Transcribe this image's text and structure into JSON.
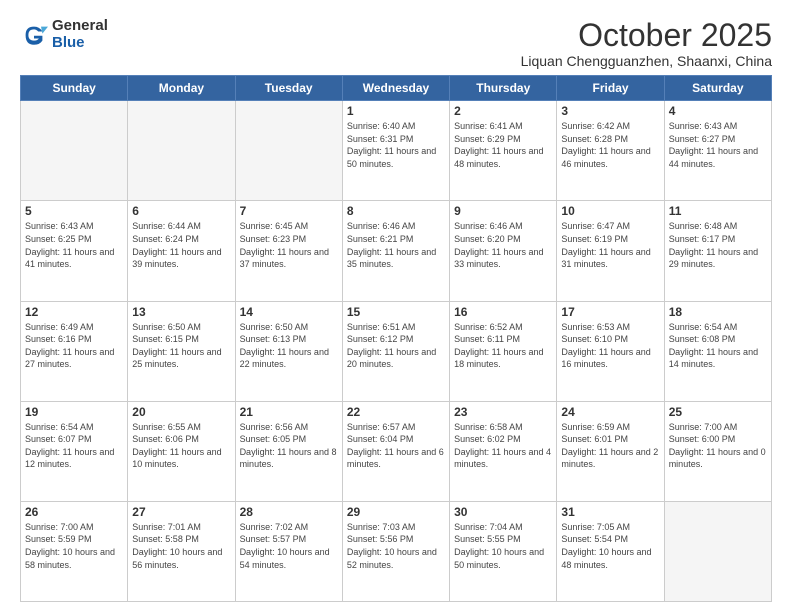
{
  "logo": {
    "general": "General",
    "blue": "Blue"
  },
  "header": {
    "month": "October 2025",
    "location": "Liquan Chengguanzhen, Shaanxi, China"
  },
  "weekdays": [
    "Sunday",
    "Monday",
    "Tuesday",
    "Wednesday",
    "Thursday",
    "Friday",
    "Saturday"
  ],
  "weeks": [
    [
      {
        "day": "",
        "sunrise": "",
        "sunset": "",
        "daylight": ""
      },
      {
        "day": "",
        "sunrise": "",
        "sunset": "",
        "daylight": ""
      },
      {
        "day": "",
        "sunrise": "",
        "sunset": "",
        "daylight": ""
      },
      {
        "day": "1",
        "sunrise": "Sunrise: 6:40 AM",
        "sunset": "Sunset: 6:31 PM",
        "daylight": "Daylight: 11 hours and 50 minutes."
      },
      {
        "day": "2",
        "sunrise": "Sunrise: 6:41 AM",
        "sunset": "Sunset: 6:29 PM",
        "daylight": "Daylight: 11 hours and 48 minutes."
      },
      {
        "day": "3",
        "sunrise": "Sunrise: 6:42 AM",
        "sunset": "Sunset: 6:28 PM",
        "daylight": "Daylight: 11 hours and 46 minutes."
      },
      {
        "day": "4",
        "sunrise": "Sunrise: 6:43 AM",
        "sunset": "Sunset: 6:27 PM",
        "daylight": "Daylight: 11 hours and 44 minutes."
      }
    ],
    [
      {
        "day": "5",
        "sunrise": "Sunrise: 6:43 AM",
        "sunset": "Sunset: 6:25 PM",
        "daylight": "Daylight: 11 hours and 41 minutes."
      },
      {
        "day": "6",
        "sunrise": "Sunrise: 6:44 AM",
        "sunset": "Sunset: 6:24 PM",
        "daylight": "Daylight: 11 hours and 39 minutes."
      },
      {
        "day": "7",
        "sunrise": "Sunrise: 6:45 AM",
        "sunset": "Sunset: 6:23 PM",
        "daylight": "Daylight: 11 hours and 37 minutes."
      },
      {
        "day": "8",
        "sunrise": "Sunrise: 6:46 AM",
        "sunset": "Sunset: 6:21 PM",
        "daylight": "Daylight: 11 hours and 35 minutes."
      },
      {
        "day": "9",
        "sunrise": "Sunrise: 6:46 AM",
        "sunset": "Sunset: 6:20 PM",
        "daylight": "Daylight: 11 hours and 33 minutes."
      },
      {
        "day": "10",
        "sunrise": "Sunrise: 6:47 AM",
        "sunset": "Sunset: 6:19 PM",
        "daylight": "Daylight: 11 hours and 31 minutes."
      },
      {
        "day": "11",
        "sunrise": "Sunrise: 6:48 AM",
        "sunset": "Sunset: 6:17 PM",
        "daylight": "Daylight: 11 hours and 29 minutes."
      }
    ],
    [
      {
        "day": "12",
        "sunrise": "Sunrise: 6:49 AM",
        "sunset": "Sunset: 6:16 PM",
        "daylight": "Daylight: 11 hours and 27 minutes."
      },
      {
        "day": "13",
        "sunrise": "Sunrise: 6:50 AM",
        "sunset": "Sunset: 6:15 PM",
        "daylight": "Daylight: 11 hours and 25 minutes."
      },
      {
        "day": "14",
        "sunrise": "Sunrise: 6:50 AM",
        "sunset": "Sunset: 6:13 PM",
        "daylight": "Daylight: 11 hours and 22 minutes."
      },
      {
        "day": "15",
        "sunrise": "Sunrise: 6:51 AM",
        "sunset": "Sunset: 6:12 PM",
        "daylight": "Daylight: 11 hours and 20 minutes."
      },
      {
        "day": "16",
        "sunrise": "Sunrise: 6:52 AM",
        "sunset": "Sunset: 6:11 PM",
        "daylight": "Daylight: 11 hours and 18 minutes."
      },
      {
        "day": "17",
        "sunrise": "Sunrise: 6:53 AM",
        "sunset": "Sunset: 6:10 PM",
        "daylight": "Daylight: 11 hours and 16 minutes."
      },
      {
        "day": "18",
        "sunrise": "Sunrise: 6:54 AM",
        "sunset": "Sunset: 6:08 PM",
        "daylight": "Daylight: 11 hours and 14 minutes."
      }
    ],
    [
      {
        "day": "19",
        "sunrise": "Sunrise: 6:54 AM",
        "sunset": "Sunset: 6:07 PM",
        "daylight": "Daylight: 11 hours and 12 minutes."
      },
      {
        "day": "20",
        "sunrise": "Sunrise: 6:55 AM",
        "sunset": "Sunset: 6:06 PM",
        "daylight": "Daylight: 11 hours and 10 minutes."
      },
      {
        "day": "21",
        "sunrise": "Sunrise: 6:56 AM",
        "sunset": "Sunset: 6:05 PM",
        "daylight": "Daylight: 11 hours and 8 minutes."
      },
      {
        "day": "22",
        "sunrise": "Sunrise: 6:57 AM",
        "sunset": "Sunset: 6:04 PM",
        "daylight": "Daylight: 11 hours and 6 minutes."
      },
      {
        "day": "23",
        "sunrise": "Sunrise: 6:58 AM",
        "sunset": "Sunset: 6:02 PM",
        "daylight": "Daylight: 11 hours and 4 minutes."
      },
      {
        "day": "24",
        "sunrise": "Sunrise: 6:59 AM",
        "sunset": "Sunset: 6:01 PM",
        "daylight": "Daylight: 11 hours and 2 minutes."
      },
      {
        "day": "25",
        "sunrise": "Sunrise: 7:00 AM",
        "sunset": "Sunset: 6:00 PM",
        "daylight": "Daylight: 11 hours and 0 minutes."
      }
    ],
    [
      {
        "day": "26",
        "sunrise": "Sunrise: 7:00 AM",
        "sunset": "Sunset: 5:59 PM",
        "daylight": "Daylight: 10 hours and 58 minutes."
      },
      {
        "day": "27",
        "sunrise": "Sunrise: 7:01 AM",
        "sunset": "Sunset: 5:58 PM",
        "daylight": "Daylight: 10 hours and 56 minutes."
      },
      {
        "day": "28",
        "sunrise": "Sunrise: 7:02 AM",
        "sunset": "Sunset: 5:57 PM",
        "daylight": "Daylight: 10 hours and 54 minutes."
      },
      {
        "day": "29",
        "sunrise": "Sunrise: 7:03 AM",
        "sunset": "Sunset: 5:56 PM",
        "daylight": "Daylight: 10 hours and 52 minutes."
      },
      {
        "day": "30",
        "sunrise": "Sunrise: 7:04 AM",
        "sunset": "Sunset: 5:55 PM",
        "daylight": "Daylight: 10 hours and 50 minutes."
      },
      {
        "day": "31",
        "sunrise": "Sunrise: 7:05 AM",
        "sunset": "Sunset: 5:54 PM",
        "daylight": "Daylight: 10 hours and 48 minutes."
      },
      {
        "day": "",
        "sunrise": "",
        "sunset": "",
        "daylight": ""
      }
    ]
  ]
}
